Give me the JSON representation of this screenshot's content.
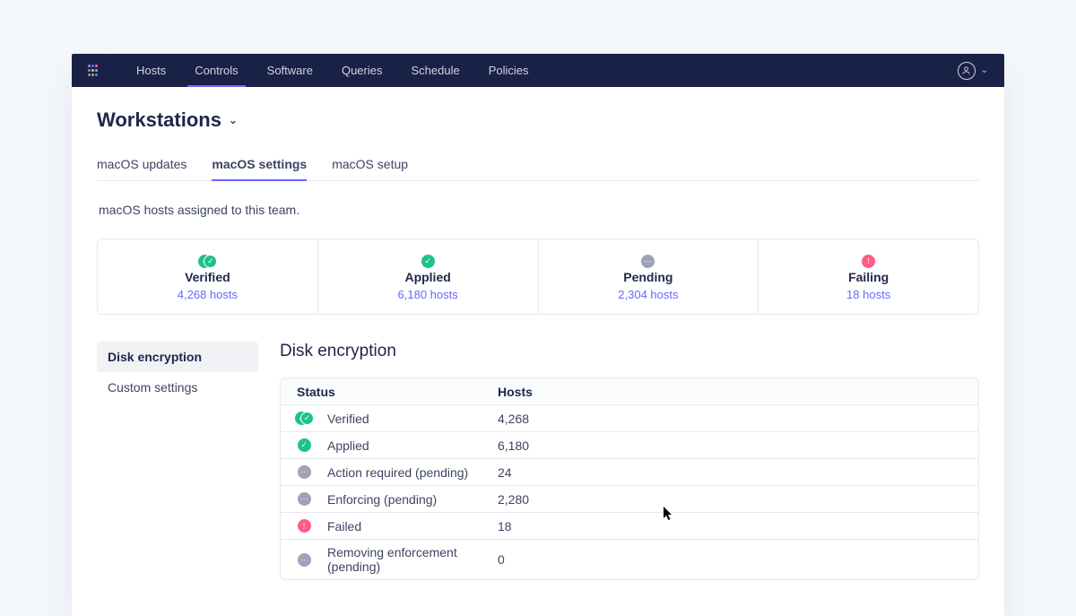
{
  "nav": {
    "items": [
      "Hosts",
      "Controls",
      "Software",
      "Queries",
      "Schedule",
      "Policies"
    ],
    "active_index": 1
  },
  "page": {
    "team_name": "Workstations",
    "description": "macOS hosts assigned to this team."
  },
  "tabs": {
    "items": [
      "macOS updates",
      "macOS settings",
      "macOS setup"
    ],
    "active_index": 1
  },
  "stats": [
    {
      "label": "Verified",
      "count": "4,268 hosts",
      "icon": "verified-multi"
    },
    {
      "label": "Applied",
      "count": "6,180 hosts",
      "icon": "applied"
    },
    {
      "label": "Pending",
      "count": "2,304 hosts",
      "icon": "pending"
    },
    {
      "label": "Failing",
      "count": "18 hosts",
      "icon": "failing"
    }
  ],
  "sidebar": {
    "items": [
      "Disk encryption",
      "Custom settings"
    ],
    "active_index": 0
  },
  "panel": {
    "title": "Disk encryption",
    "columns": {
      "status": "Status",
      "hosts": "Hosts"
    },
    "rows": [
      {
        "icon": "verified-multi",
        "status": "Verified",
        "hosts": "4,268"
      },
      {
        "icon": "applied",
        "status": "Applied",
        "hosts": "6,180"
      },
      {
        "icon": "pending",
        "status": "Action required (pending)",
        "hosts": "24"
      },
      {
        "icon": "pending",
        "status": "Enforcing (pending)",
        "hosts": "2,280"
      },
      {
        "icon": "failing",
        "status": "Failed",
        "hosts": "18"
      },
      {
        "icon": "pending",
        "status": "Removing enforcement (pending)",
        "hosts": "0"
      }
    ]
  }
}
